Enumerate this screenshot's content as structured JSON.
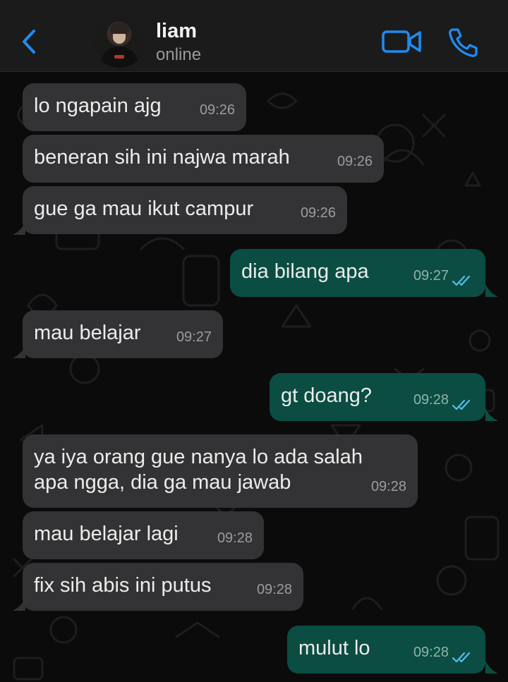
{
  "header": {
    "contact_name": "liam",
    "contact_status": "online",
    "accent_color": "#1f8cf0"
  },
  "messages": [
    {
      "text": "lo ngapain ajg",
      "time": "09:26",
      "direction": "incoming"
    },
    {
      "text": "beneran sih ini najwa marah",
      "time": "09:26",
      "direction": "incoming"
    },
    {
      "text": "gue ga mau ikut campur",
      "time": "09:26",
      "direction": "incoming"
    },
    {
      "text": "dia bilang apa",
      "time": "09:27",
      "direction": "outgoing",
      "status": "read"
    },
    {
      "text": "mau belajar",
      "time": "09:27",
      "direction": "incoming"
    },
    {
      "text": "gt doang?",
      "time": "09:28",
      "direction": "outgoing",
      "status": "read"
    },
    {
      "text": "ya iya orang gue nanya lo ada salah\napa ngga, dia ga mau jawab",
      "time": "09:28",
      "direction": "incoming"
    },
    {
      "text": "mau belajar lagi",
      "time": "09:28",
      "direction": "incoming"
    },
    {
      "text": "fix sih abis ini putus",
      "time": "09:28",
      "direction": "incoming"
    },
    {
      "text": "mulut lo",
      "time": "09:28",
      "direction": "outgoing",
      "status": "read"
    }
  ]
}
